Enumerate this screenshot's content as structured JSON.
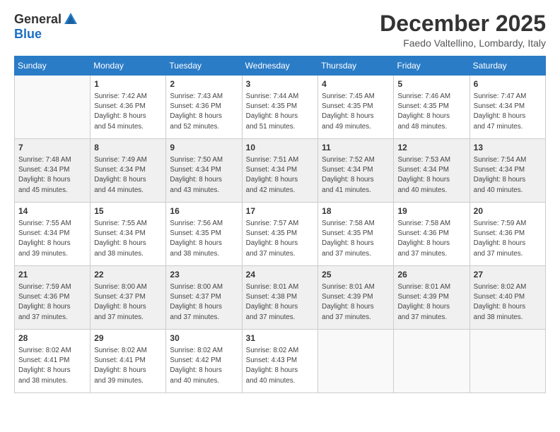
{
  "logo": {
    "general": "General",
    "blue": "Blue"
  },
  "title": "December 2025",
  "location": "Faedo Valtellino, Lombardy, Italy",
  "days_header": [
    "Sunday",
    "Monday",
    "Tuesday",
    "Wednesday",
    "Thursday",
    "Friday",
    "Saturday"
  ],
  "weeks": [
    [
      {
        "day": "",
        "info": ""
      },
      {
        "day": "1",
        "info": "Sunrise: 7:42 AM\nSunset: 4:36 PM\nDaylight: 8 hours\nand 54 minutes."
      },
      {
        "day": "2",
        "info": "Sunrise: 7:43 AM\nSunset: 4:36 PM\nDaylight: 8 hours\nand 52 minutes."
      },
      {
        "day": "3",
        "info": "Sunrise: 7:44 AM\nSunset: 4:35 PM\nDaylight: 8 hours\nand 51 minutes."
      },
      {
        "day": "4",
        "info": "Sunrise: 7:45 AM\nSunset: 4:35 PM\nDaylight: 8 hours\nand 49 minutes."
      },
      {
        "day": "5",
        "info": "Sunrise: 7:46 AM\nSunset: 4:35 PM\nDaylight: 8 hours\nand 48 minutes."
      },
      {
        "day": "6",
        "info": "Sunrise: 7:47 AM\nSunset: 4:34 PM\nDaylight: 8 hours\nand 47 minutes."
      }
    ],
    [
      {
        "day": "7",
        "info": "Sunrise: 7:48 AM\nSunset: 4:34 PM\nDaylight: 8 hours\nand 45 minutes."
      },
      {
        "day": "8",
        "info": "Sunrise: 7:49 AM\nSunset: 4:34 PM\nDaylight: 8 hours\nand 44 minutes."
      },
      {
        "day": "9",
        "info": "Sunrise: 7:50 AM\nSunset: 4:34 PM\nDaylight: 8 hours\nand 43 minutes."
      },
      {
        "day": "10",
        "info": "Sunrise: 7:51 AM\nSunset: 4:34 PM\nDaylight: 8 hours\nand 42 minutes."
      },
      {
        "day": "11",
        "info": "Sunrise: 7:52 AM\nSunset: 4:34 PM\nDaylight: 8 hours\nand 41 minutes."
      },
      {
        "day": "12",
        "info": "Sunrise: 7:53 AM\nSunset: 4:34 PM\nDaylight: 8 hours\nand 40 minutes."
      },
      {
        "day": "13",
        "info": "Sunrise: 7:54 AM\nSunset: 4:34 PM\nDaylight: 8 hours\nand 40 minutes."
      }
    ],
    [
      {
        "day": "14",
        "info": "Sunrise: 7:55 AM\nSunset: 4:34 PM\nDaylight: 8 hours\nand 39 minutes."
      },
      {
        "day": "15",
        "info": "Sunrise: 7:55 AM\nSunset: 4:34 PM\nDaylight: 8 hours\nand 38 minutes."
      },
      {
        "day": "16",
        "info": "Sunrise: 7:56 AM\nSunset: 4:35 PM\nDaylight: 8 hours\nand 38 minutes."
      },
      {
        "day": "17",
        "info": "Sunrise: 7:57 AM\nSunset: 4:35 PM\nDaylight: 8 hours\nand 37 minutes."
      },
      {
        "day": "18",
        "info": "Sunrise: 7:58 AM\nSunset: 4:35 PM\nDaylight: 8 hours\nand 37 minutes."
      },
      {
        "day": "19",
        "info": "Sunrise: 7:58 AM\nSunset: 4:36 PM\nDaylight: 8 hours\nand 37 minutes."
      },
      {
        "day": "20",
        "info": "Sunrise: 7:59 AM\nSunset: 4:36 PM\nDaylight: 8 hours\nand 37 minutes."
      }
    ],
    [
      {
        "day": "21",
        "info": "Sunrise: 7:59 AM\nSunset: 4:36 PM\nDaylight: 8 hours\nand 37 minutes."
      },
      {
        "day": "22",
        "info": "Sunrise: 8:00 AM\nSunset: 4:37 PM\nDaylight: 8 hours\nand 37 minutes."
      },
      {
        "day": "23",
        "info": "Sunrise: 8:00 AM\nSunset: 4:37 PM\nDaylight: 8 hours\nand 37 minutes."
      },
      {
        "day": "24",
        "info": "Sunrise: 8:01 AM\nSunset: 4:38 PM\nDaylight: 8 hours\nand 37 minutes."
      },
      {
        "day": "25",
        "info": "Sunrise: 8:01 AM\nSunset: 4:39 PM\nDaylight: 8 hours\nand 37 minutes."
      },
      {
        "day": "26",
        "info": "Sunrise: 8:01 AM\nSunset: 4:39 PM\nDaylight: 8 hours\nand 37 minutes."
      },
      {
        "day": "27",
        "info": "Sunrise: 8:02 AM\nSunset: 4:40 PM\nDaylight: 8 hours\nand 38 minutes."
      }
    ],
    [
      {
        "day": "28",
        "info": "Sunrise: 8:02 AM\nSunset: 4:41 PM\nDaylight: 8 hours\nand 38 minutes."
      },
      {
        "day": "29",
        "info": "Sunrise: 8:02 AM\nSunset: 4:41 PM\nDaylight: 8 hours\nand 39 minutes."
      },
      {
        "day": "30",
        "info": "Sunrise: 8:02 AM\nSunset: 4:42 PM\nDaylight: 8 hours\nand 40 minutes."
      },
      {
        "day": "31",
        "info": "Sunrise: 8:02 AM\nSunset: 4:43 PM\nDaylight: 8 hours\nand 40 minutes."
      },
      {
        "day": "",
        "info": ""
      },
      {
        "day": "",
        "info": ""
      },
      {
        "day": "",
        "info": ""
      }
    ]
  ]
}
